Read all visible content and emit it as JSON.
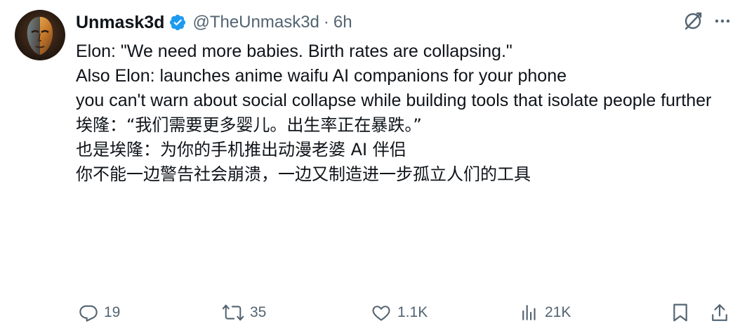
{
  "tweet": {
    "author": {
      "display_name": "Unmask3d",
      "handle": "@TheUnmask3d",
      "separator": "·",
      "time": "6h",
      "verified_color": "#1d9bf0"
    },
    "text_en": [
      "Elon: \"We need more babies. Birth rates are collapsing.\"",
      "Also Elon: launches anime waifu AI companions for your phone",
      "you can't warn about social collapse while building tools that isolate people further"
    ],
    "text_zh": [
      "埃隆：“我们需要更多婴儿。出生率正在暴跌。”",
      "也是埃隆：为你的手机推出动漫老婆 AI 伴侣",
      "你不能一边警告社会崩溃，一边又制造进一步孤立人们的工具"
    ],
    "actions": {
      "replies": "19",
      "reposts": "35",
      "likes": "1.1K",
      "views": "21K"
    },
    "icons": {
      "header": [
        "grok-icon",
        "more-icon"
      ],
      "actions": [
        "reply-icon",
        "repost-icon",
        "like-icon",
        "views-icon",
        "bookmark-icon",
        "share-icon"
      ]
    },
    "colors": {
      "text": "#0f1419",
      "secondary": "#536471",
      "accent": "#1d9bf0"
    }
  }
}
